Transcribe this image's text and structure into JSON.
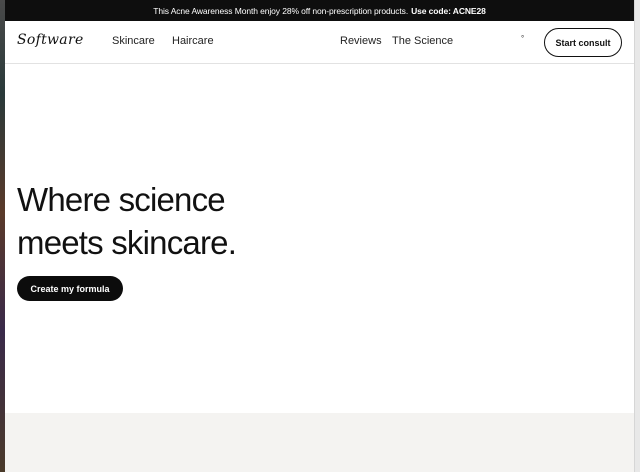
{
  "promo": {
    "text": "This Acne Awareness Month enjoy 28% off non-prescription products.",
    "code_text": "Use code: ACNE28"
  },
  "nav": {
    "logo": "Software",
    "links": [
      "Skincare",
      "Haircare",
      "Reviews",
      "The Science"
    ],
    "small_marker": "°",
    "consult_label": "Start consult"
  },
  "hero": {
    "title_line1": "Where science",
    "title_line2": "meets skincare.",
    "cta_label": "Create my formula"
  },
  "colors": {
    "promo_bg": "#0e0e0e",
    "button_bg": "#0c0c0c",
    "footer_band": "#f4f3f1"
  }
}
